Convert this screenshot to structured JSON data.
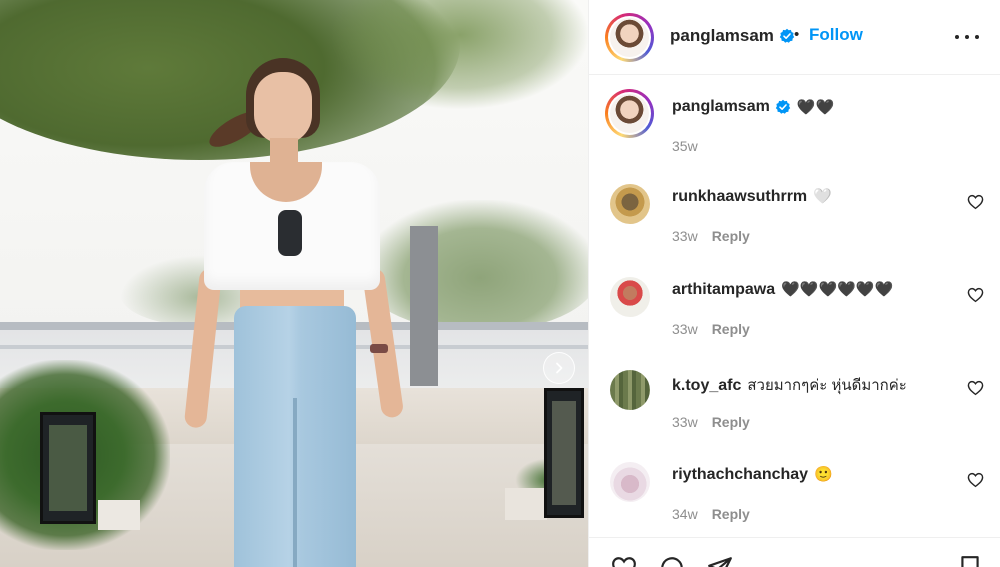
{
  "post": {
    "header": {
      "username": "panglamsam",
      "separator": "•",
      "follow_label": "Follow"
    },
    "caption": {
      "username": "panglamsam",
      "text": "🖤🖤",
      "time": "35w"
    },
    "comments": [
      {
        "username": "runkhaawsuthrrm",
        "text": "🤍",
        "time": "33w",
        "reply_label": "Reply"
      },
      {
        "username": "arthitampawa",
        "text": "🖤🖤🖤🖤🖤🖤",
        "time": "33w",
        "reply_label": "Reply"
      },
      {
        "username": "k.toy_afc",
        "text": "สวยมากๆค่ะ หุ่นดีมากค่ะ",
        "time": "33w",
        "reply_label": "Reply"
      },
      {
        "username": "riythachchanchay",
        "text": "🙂",
        "time": "34w",
        "reply_label": "Reply"
      }
    ]
  },
  "icons": {
    "verified": "verified-badge-icon",
    "more": "more-options-icon",
    "like": "heart-icon",
    "next": "chevron-right-icon",
    "comment": "comment-bubble-icon",
    "share": "paper-plane-icon",
    "save": "bookmark-icon"
  },
  "colors": {
    "accent": "#0095f6",
    "text": "#262626",
    "muted": "#8e8e8e",
    "divider": "#efefef"
  }
}
